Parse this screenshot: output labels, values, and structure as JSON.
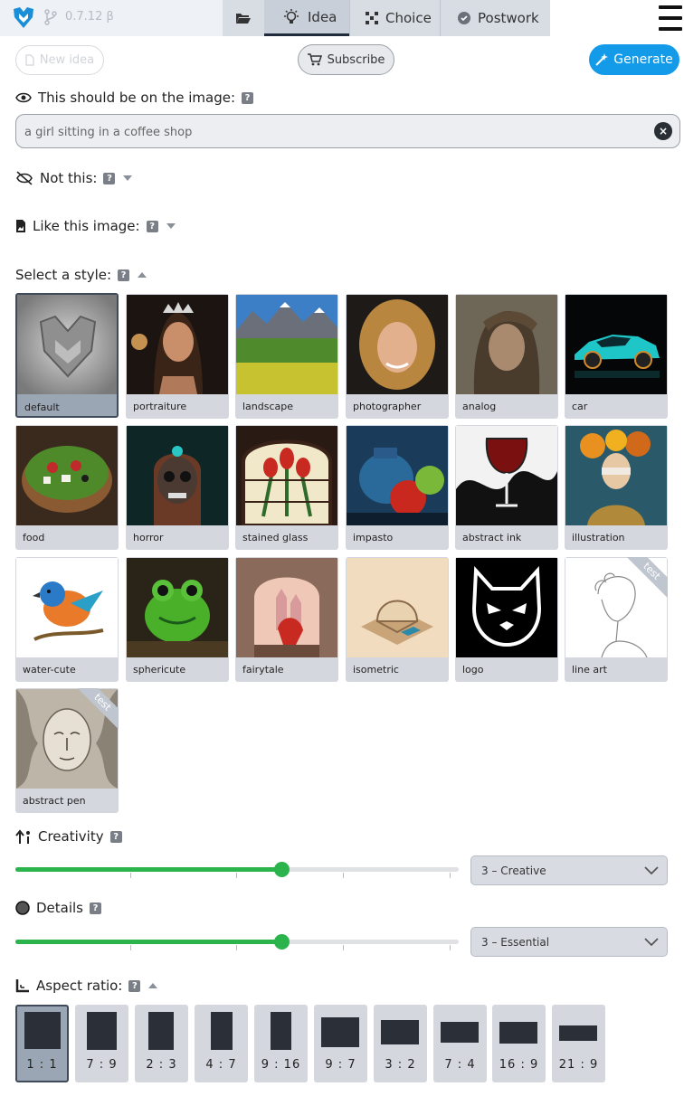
{
  "topbar": {
    "version": "0.7.12 β",
    "tabs": [
      {
        "label": "",
        "icon": "folder-open-icon"
      },
      {
        "label": "Idea",
        "icon": "lightbulb-icon"
      },
      {
        "label": "Choice",
        "icon": "grid-icon"
      },
      {
        "label": "Postwork",
        "icon": "check-circle-icon"
      }
    ]
  },
  "actions": {
    "new_idea": "New idea",
    "subscribe": "Subscribe",
    "generate": "Generate"
  },
  "prompt": {
    "label": "This should be on the image:",
    "help": "?",
    "value": "a girl sitting in a coffee shop"
  },
  "negative": {
    "label": "Not this:",
    "help": "?"
  },
  "like_image": {
    "label": "Like this image:",
    "help": "?"
  },
  "style": {
    "label": "Select a style:",
    "help": "?",
    "selected": "default",
    "items": [
      {
        "name": "default"
      },
      {
        "name": "portraiture"
      },
      {
        "name": "landscape"
      },
      {
        "name": "photographer"
      },
      {
        "name": "analog"
      },
      {
        "name": "car"
      },
      {
        "name": "food"
      },
      {
        "name": "horror"
      },
      {
        "name": "stained glass"
      },
      {
        "name": "impasto"
      },
      {
        "name": "abstract ink"
      },
      {
        "name": "illustration"
      },
      {
        "name": "water-cute"
      },
      {
        "name": "sphericute"
      },
      {
        "name": "fairytale"
      },
      {
        "name": "isometric"
      },
      {
        "name": "logo"
      },
      {
        "name": "line art",
        "badge": "test"
      },
      {
        "name": "abstract pen",
        "badge": "test"
      }
    ]
  },
  "creativity": {
    "label": "Creativity",
    "help": "?",
    "value": 3,
    "max": 5,
    "selected_option": "3 – Creative"
  },
  "details": {
    "label": "Details",
    "help": "?",
    "value": 3,
    "max": 5,
    "selected_option": "3 – Essential"
  },
  "aspect_ratio": {
    "label": "Aspect ratio:",
    "help": "?",
    "selected": "1 : 1",
    "options": [
      "1 : 1",
      "7 : 9",
      "2 : 3",
      "4 : 7",
      "9 : 16",
      "9 : 7",
      "3 : 2",
      "7 : 4",
      "16 : 9",
      "21 : 9"
    ]
  },
  "colors": {
    "accent": "#139bea",
    "slider": "#2bb34c"
  }
}
